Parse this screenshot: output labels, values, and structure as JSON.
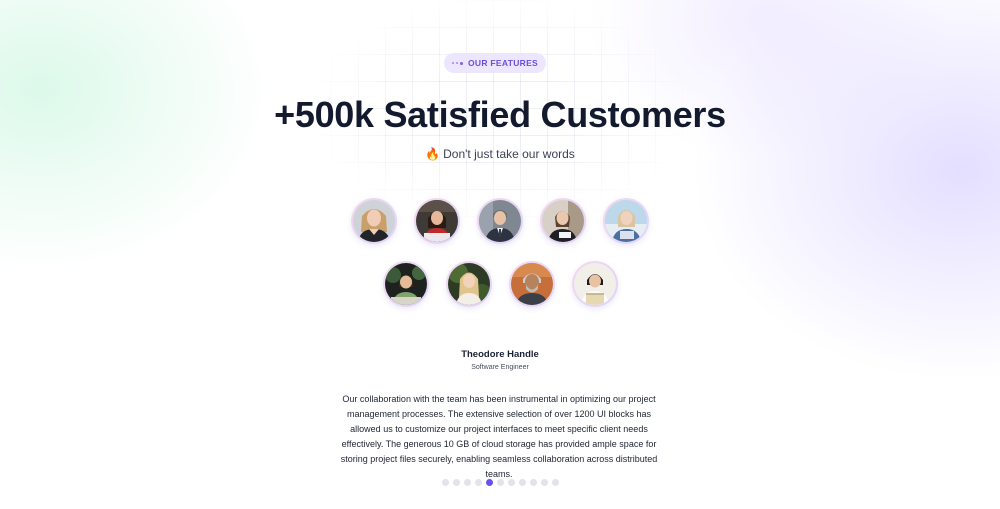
{
  "badge": {
    "label": "OUR FEATURES",
    "icon": "dots-icon"
  },
  "hero": {
    "title": "+500k Satisfied Customers",
    "subtitle_emoji": "🔥",
    "subtitle": "Don't just take our words"
  },
  "avatars": {
    "row1": [
      "avatar-1",
      "avatar-2",
      "avatar-3",
      "avatar-4",
      "avatar-5"
    ],
    "row2": [
      "avatar-6",
      "avatar-7",
      "avatar-8",
      "avatar-9"
    ]
  },
  "testimonial": {
    "name": "Theodore Handle",
    "role": "Software Engineer",
    "quote": "Our collaboration with the team has been instrumental in optimizing our project management processes. The extensive selection of over 1200 UI blocks has allowed us to customize our project interfaces to meet specific client needs effectively. The generous 10 GB of cloud storage has provided ample space for storing project files securely, enabling seamless collaboration across distributed teams."
  },
  "pagination": {
    "total": 11,
    "active_index": 4
  },
  "colors": {
    "accent": "#6b4ff0",
    "title": "#131a2e",
    "badge_bg": "#ece6ff"
  }
}
